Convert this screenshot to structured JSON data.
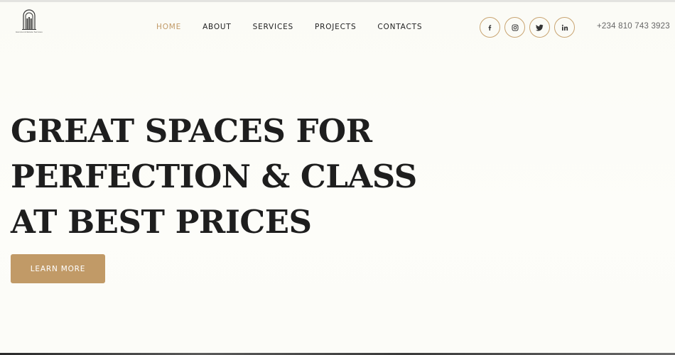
{
  "brand": {
    "logo_caption": "Hammond Estate Services",
    "accent_color": "#c19a67"
  },
  "nav": {
    "items": [
      {
        "label": "HOME",
        "active": true
      },
      {
        "label": "ABOUT",
        "active": false
      },
      {
        "label": "SERVICES",
        "active": false
      },
      {
        "label": "PROJECTS",
        "active": false
      },
      {
        "label": "CONTACTS",
        "active": false
      }
    ]
  },
  "socials": [
    {
      "icon": "facebook-icon",
      "glyph": "f"
    },
    {
      "icon": "instagram-icon",
      "glyph": ""
    },
    {
      "icon": "twitter-icon",
      "glyph": ""
    },
    {
      "icon": "linkedin-icon",
      "glyph": "in"
    }
  ],
  "contact": {
    "phone": "+234 810 743 3923"
  },
  "hero": {
    "title_lines": [
      "GREAT SPACES FOR",
      "PERFECTION & CLASS",
      "AT BEST PRICES"
    ],
    "cta_label": "LEARN MORE"
  }
}
